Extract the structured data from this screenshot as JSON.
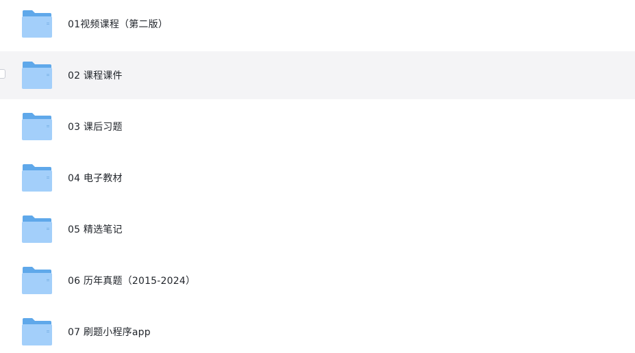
{
  "folders": [
    {
      "name": "01视频课程（第二版）",
      "icon": "folder-icon"
    },
    {
      "name": "02 课程课件",
      "icon": "folder-icon",
      "hovered": true
    },
    {
      "name": "03 课后习题",
      "icon": "folder-icon"
    },
    {
      "name": "04 电子教材",
      "icon": "folder-icon"
    },
    {
      "name": "05 精选笔记",
      "icon": "folder-icon"
    },
    {
      "name": "06 历年真题（2015-2024）",
      "icon": "folder-icon"
    },
    {
      "name": "07 刷题小程序app",
      "icon": "folder-icon"
    }
  ],
  "colors": {
    "folder_back": "#5fa8ea",
    "folder_front_top": "#a9d3fb",
    "folder_front_bottom": "#8ec4f6",
    "hover_bg": "#f4f4f6",
    "text": "#1f2329"
  }
}
